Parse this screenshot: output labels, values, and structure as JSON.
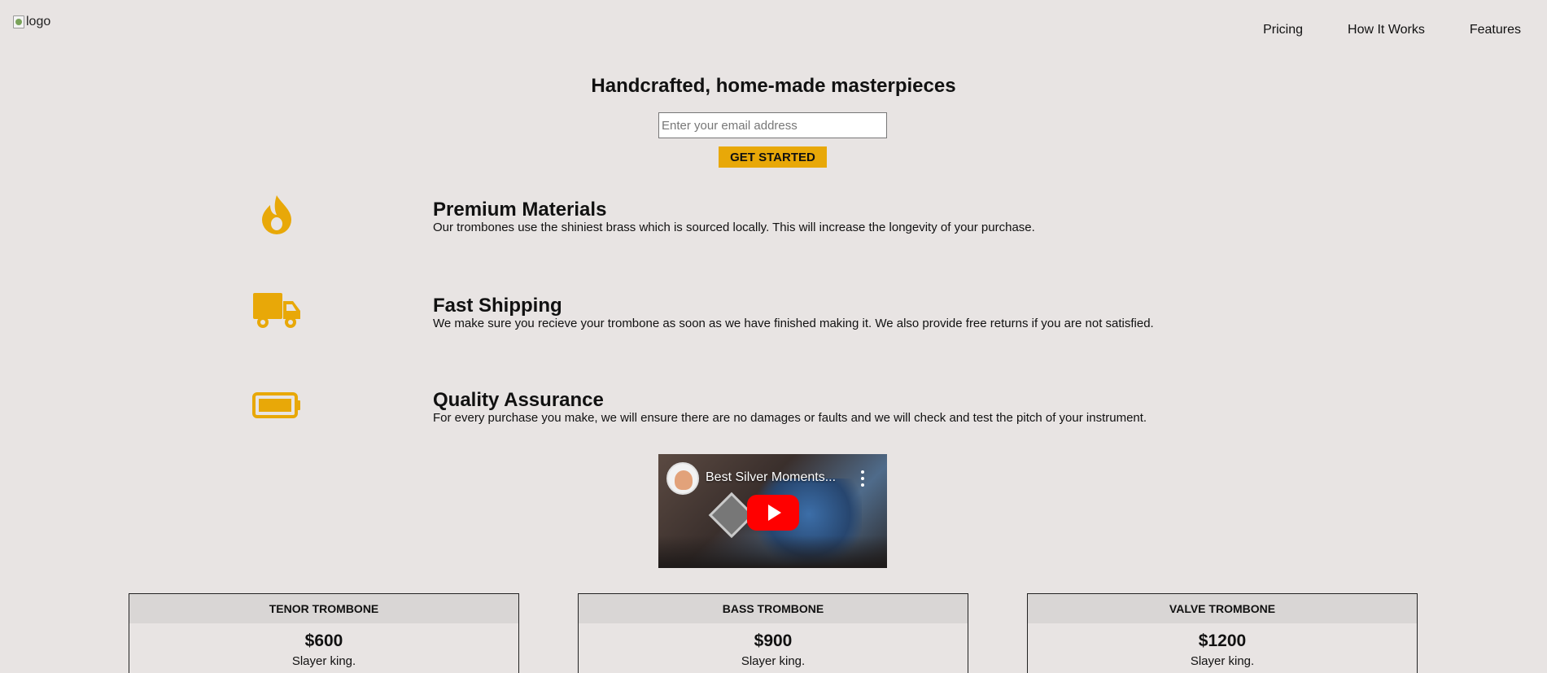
{
  "header": {
    "logo_alt": "logo",
    "nav": [
      "Pricing",
      "How It Works",
      "Features"
    ]
  },
  "hero": {
    "title": "Handcrafted, home-made masterpieces",
    "email_placeholder": "Enter your email address",
    "cta_label": "GET STARTED"
  },
  "features": [
    {
      "icon": "fire-icon",
      "title": "Premium Materials",
      "text": "Our trombones use the shiniest brass which is sourced locally. This will increase the longevity of your purchase."
    },
    {
      "icon": "truck-icon",
      "title": "Fast Shipping",
      "text": "We make sure you recieve your trombone as soon as we have finished making it. We also provide free returns if you are not satisfied."
    },
    {
      "icon": "battery-icon",
      "title": "Quality Assurance",
      "text": "For every purchase you make, we will ensure there are no damages or faults and we will check and test the pitch of your instrument."
    }
  ],
  "video": {
    "title": "Best Silver Moments..."
  },
  "pricing": [
    {
      "name": "TENOR TROMBONE",
      "price": "$600",
      "desc": "Slayer king."
    },
    {
      "name": "BASS TROMBONE",
      "price": "$900",
      "desc": "Slayer king."
    },
    {
      "name": "VALVE TROMBONE",
      "price": "$1200",
      "desc": "Slayer king."
    }
  ],
  "colors": {
    "accent": "#e8a808",
    "background": "#e8e4e3",
    "card_header": "#d9d6d5"
  }
}
